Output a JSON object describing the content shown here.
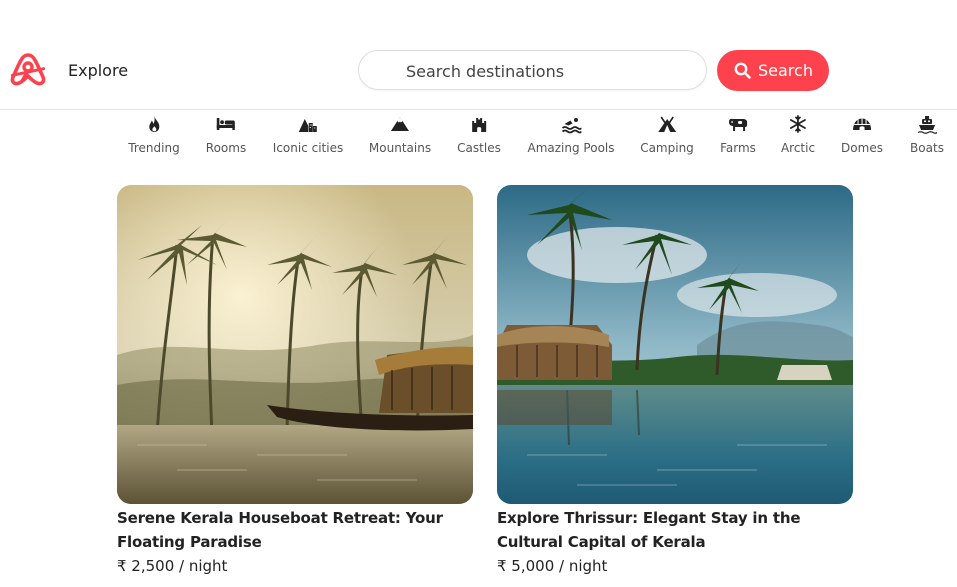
{
  "header": {
    "explore_label": "Explore",
    "search": {
      "placeholder": "Search destinations"
    },
    "search_button_label": "Search",
    "accent_color": "#fe424d"
  },
  "filters": [
    {
      "label": "Trending",
      "icon": "fire-icon"
    },
    {
      "label": "Rooms",
      "icon": "bed-icon"
    },
    {
      "label": "Iconic cities",
      "icon": "mountain-city-icon"
    },
    {
      "label": "Mountains",
      "icon": "mountain-icon"
    },
    {
      "label": "Castles",
      "icon": "castle-icon"
    },
    {
      "label": "Amazing Pools",
      "icon": "swimmer-icon"
    },
    {
      "label": "Camping",
      "icon": "tent-icon"
    },
    {
      "label": "Farms",
      "icon": "cow-icon"
    },
    {
      "label": "Arctic",
      "icon": "snowflake-icon"
    },
    {
      "label": "Domes",
      "icon": "igloo-icon"
    },
    {
      "label": "Boats",
      "icon": "ship-icon"
    }
  ],
  "listings": [
    {
      "title": "Serene Kerala Houseboat Retreat: Your Floating Paradise",
      "price": "₹ 2,500 / night"
    },
    {
      "title": "Explore Thrissur: Elegant Stay in the Cultural Capital of Kerala",
      "price": "₹ 5,000 / night"
    }
  ]
}
